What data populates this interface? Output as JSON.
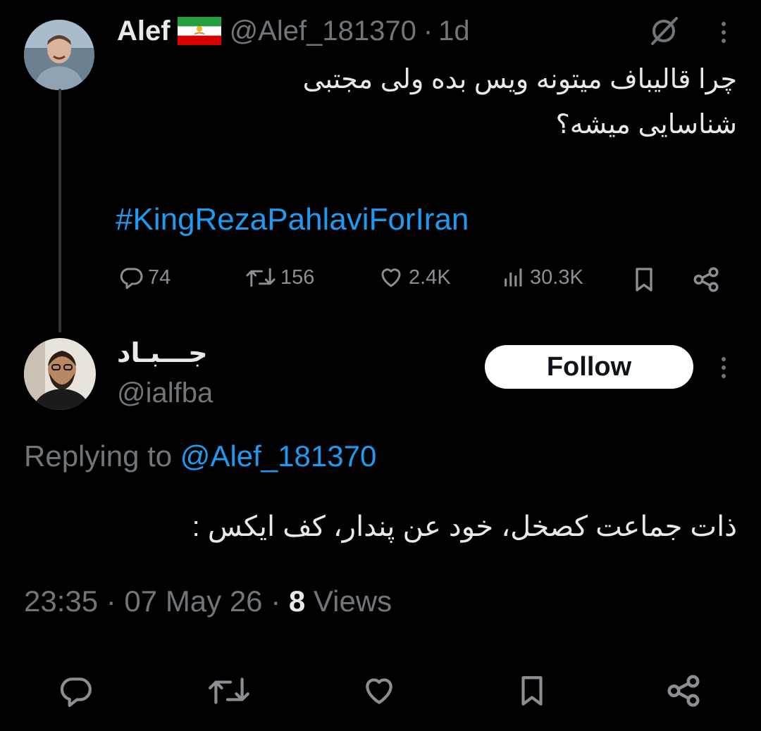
{
  "original_tweet": {
    "author_name": "Alef",
    "handle": "@Alef_181370",
    "separator": "·",
    "time": "1d",
    "text_line1": "چرا قالیباف میتونه ویس بده ولی مجتبی",
    "text_line2": "شناسایی میشه؟",
    "hashtag": "#KingRezaPahlaviForIran",
    "stats": {
      "replies": "74",
      "reposts": "156",
      "likes": "2.4K",
      "views": "30.3K"
    }
  },
  "reply_tweet": {
    "author_name": "جـــبـاد",
    "handle": "@ialfba",
    "follow_label": "Follow",
    "replying_prefix": "Replying to",
    "replying_handle": "@Alef_181370",
    "text": "ذات جماعت کصخل، خود عن پندار، کف ایکس :",
    "timestamp": "23:35 · 07 May 26 · ",
    "views_count": "8",
    "views_label": "Views"
  },
  "icons": {
    "flag": "iran-lion-sun-flag-icon",
    "grok": "grok-icon",
    "more": "more-vertical-icon",
    "reply": "reply-icon",
    "repost": "repost-icon",
    "like": "heart-icon",
    "views": "views-chart-icon",
    "bookmark": "bookmark-icon",
    "share": "share-icon"
  },
  "colors": {
    "background": "#000000",
    "text": "#e7e9ea",
    "secondary": "#71767b",
    "link": "#1d9bf0"
  }
}
